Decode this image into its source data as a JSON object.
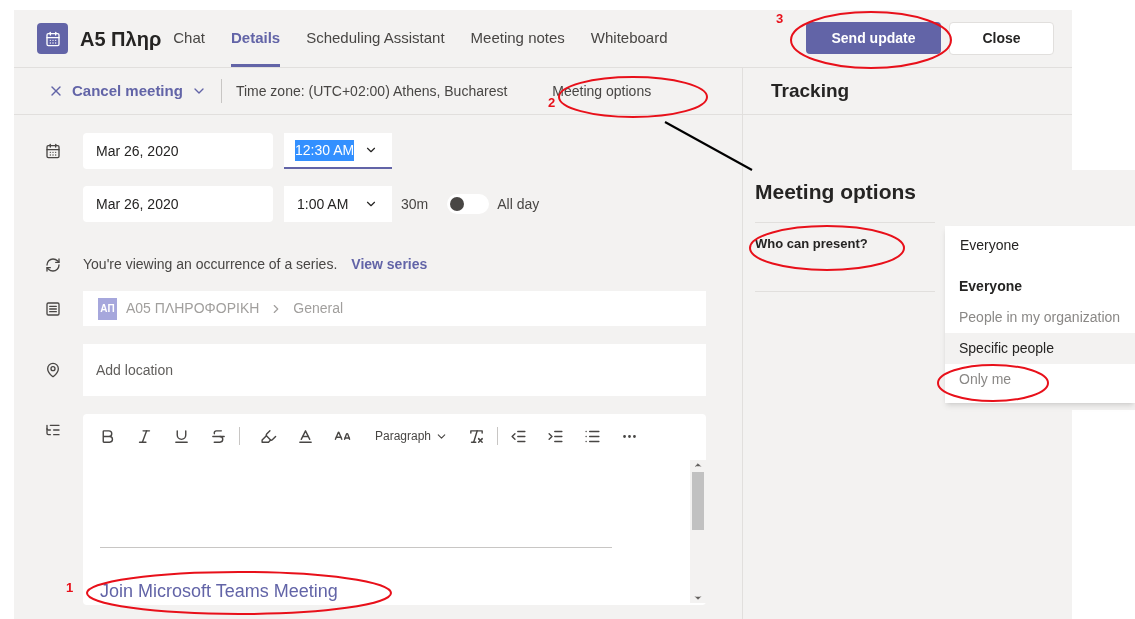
{
  "header": {
    "title": "A5 Πληρ",
    "tabs": [
      {
        "label": "Chat",
        "selected": false
      },
      {
        "label": "Details",
        "selected": true
      },
      {
        "label": "Scheduling Assistant",
        "selected": false
      },
      {
        "label": "Meeting notes",
        "selected": false
      },
      {
        "label": "Whiteboard",
        "selected": false
      }
    ],
    "buttons": [
      {
        "label": "Send update",
        "kind": "primary"
      },
      {
        "label": "Close",
        "kind": "secondary"
      }
    ]
  },
  "toolbar": {
    "cancel": "Cancel meeting",
    "timezone": "Time zone: (UTC+02:00) Athens, Bucharest",
    "options_link": "Meeting options"
  },
  "form": {
    "start_date": "Mar 26, 2020",
    "start_time": "12:30 AM",
    "start_time_highlighted": true,
    "end_date": "Mar 26, 2020",
    "end_time": "1:00 AM",
    "duration": "30m",
    "all_day": {
      "label": "All day",
      "on": false
    },
    "series_note": "You're viewing an occurrence of a series.",
    "series_link": "View series",
    "channel": {
      "badge": "ΑΠ",
      "team": "A05 ΠΛΗΡΟΦΟΡΙΚΗ",
      "name": "General"
    },
    "location_placeholder": "Add location",
    "editor": {
      "paragraph": "Paragraph",
      "link": "Join Microsoft Teams Meeting"
    }
  },
  "tracking": {
    "title": "Tracking"
  },
  "meeting_options": {
    "title": "Meeting options",
    "question": "Who can present?",
    "value": "Everyone",
    "options": [
      {
        "label": "Everyone",
        "selected": true,
        "hovered": false
      },
      {
        "label": "People in my organization",
        "selected": false,
        "hovered": false
      },
      {
        "label": "Specific people",
        "selected": false,
        "hovered": true
      },
      {
        "label": "Only me",
        "selected": false,
        "hovered": false
      }
    ]
  },
  "annotations": [
    "1",
    "2",
    "3"
  ]
}
